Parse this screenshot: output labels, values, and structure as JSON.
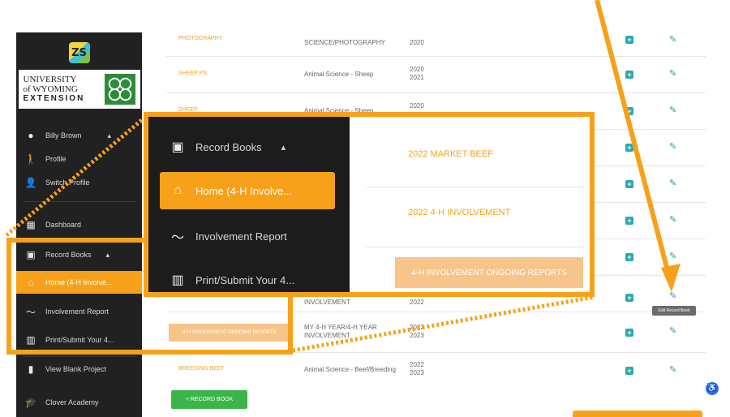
{
  "sidebar": {
    "user_name": "Billy Brown",
    "logo_letters": "ZS",
    "university_line1": "UNIVERSITY",
    "university_line2": "of WYOMING",
    "university_line3": "EXTENSION",
    "items": [
      {
        "label": "Profile",
        "icon": "profile-icon"
      },
      {
        "label": "Switch Profile",
        "icon": "switch-profile-icon"
      },
      {
        "label": "Dashboard",
        "icon": "dashboard-icon"
      },
      {
        "label": "Record Books",
        "icon": "record-books-icon"
      },
      {
        "label": "Home (4-H Involve...",
        "icon": "home-icon"
      },
      {
        "label": "Involvement Report",
        "icon": "trend-icon"
      },
      {
        "label": "Print/Submit Your 4...",
        "icon": "print-icon"
      },
      {
        "label": "View Blank Project",
        "icon": "project-icon"
      },
      {
        "label": "Clover Academy",
        "icon": "graduation-icon"
      }
    ]
  },
  "table": {
    "rows": [
      {
        "name": "PHOTOGRAPHY",
        "type": "SCIENCE/PHOTOGRAPHY",
        "years": "2020"
      },
      {
        "name": "SHEEP PS",
        "type": "Animal Science - Sheep",
        "years": "2020\n2021"
      },
      {
        "name": "SHEEP",
        "type": "Animal Science - Sheep",
        "years": "2020"
      },
      {
        "name": "2022 MARKET BEEF",
        "type": "",
        "years": ""
      },
      {
        "name": "",
        "type": "",
        "years": ""
      },
      {
        "name": "2022 4-H INVOLVEMENT",
        "type": "",
        "years": ""
      },
      {
        "name": "",
        "type": "",
        "years": ""
      },
      {
        "name": "",
        "type": "INVOLVEMENT",
        "years": "2022"
      },
      {
        "name": "4-H INVOLVEMENT ONGOING REPORTS",
        "type": "MY 4-H YEAR/4-H YEAR\nINVOLVEMENT",
        "years": "2022\n2023"
      },
      {
        "name": "BREEDING BEEF",
        "type": "Animal Science - Beef/Breeding",
        "years": "2022\n2023"
      }
    ],
    "record_book_button": "+ RECORD BOOK",
    "tooltip": "Edit Record Book"
  },
  "zoom": {
    "record_books": "Record Books",
    "home": "Home (4-H Involve...",
    "involvement_report": "Involvement Report",
    "print_submit": "Print/Submit Your 4...",
    "market_beef": "2022 MARKET BEEF",
    "involvement": "2022 4-H INVOLVEMENT",
    "ongoing": "4-H INVOLVEMENT ONGOING REPORTS"
  },
  "colors": {
    "accent": "#f7a11a",
    "sidebar_bg": "#212121",
    "teal": "#2ba8b0",
    "green": "#3bb54a"
  }
}
